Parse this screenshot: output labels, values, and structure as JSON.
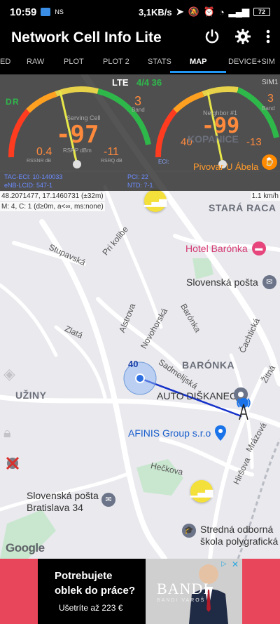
{
  "statusbar": {
    "time": "10:59",
    "ns_label": "NS",
    "speed": "3,1KB/s",
    "battery": "72"
  },
  "appbar": {
    "title": "Network Cell Info Lite",
    "icons": [
      "power-icon",
      "gear-icon",
      "more-vertical-icon"
    ]
  },
  "tabs": {
    "items": [
      "ED",
      "RAW",
      "PLOT",
      "PLOT 2",
      "STATS",
      "MAP",
      "DEVICE+SIM"
    ],
    "active": "MAP"
  },
  "signal_panel": {
    "technology": "LTE",
    "network": "4/4 36",
    "sim_label": "SIM1",
    "serving_cell_label": "Serving Cell",
    "neighbor_label": "Neighbor #1",
    "left_gauge": {
      "d_letter": "D",
      "r_letter": "R",
      "rsrp_value": "-97",
      "rsrp_unit": "RSRP dBm",
      "band_value": "3",
      "band_label": "Band",
      "rssnr_value": "0.4",
      "rssnr_unit": "RSSNR dB",
      "rsrq_value": "-11",
      "rsrq_unit": "RSRQ dB",
      "scale": [
        "-140",
        "-130",
        "-120",
        "-110",
        "-100",
        "-90",
        "-80",
        "-70",
        "-60",
        "-50",
        "-40"
      ],
      "needle_value": -97
    },
    "right_gauge": {
      "rsrp_value": "-99",
      "rsrp_unit": "RSRP dBm",
      "band_value": "3",
      "band_label": "Band",
      "rsrq_value": "-13",
      "rsrq_unit": "RSRQ dB",
      "rssnr_value": "40",
      "ci_label": "ECI:",
      "pci_label": "PCI:",
      "pci_value": "22",
      "scale": [
        "-140",
        "-130",
        "-120",
        "-110",
        "-100",
        "-90",
        "-80",
        "-70",
        "-60",
        "-50",
        "-40"
      ],
      "needle_value": -99
    },
    "cell_info": {
      "tac_eci": "TAC-ECI: 10-140033",
      "enb_lcid": "eNB-LCID: 547-1",
      "pci": "PCI: 22",
      "ntd": "NTD: 7-1"
    },
    "coords": "48.2071477, 17.1460731 (±32m)",
    "speed": "1.1 km/h",
    "mode": "M: 4, C: 1 (d≥0m, a<∞, ms:none)"
  },
  "map": {
    "districts": [
      "STARÁ RACA",
      "BARÓNKA",
      "UŽINY"
    ],
    "streets": [
      "Stupavská",
      "Pri kolibe",
      "Alstrova",
      "Novohorská",
      "Barónka",
      "Zlatá",
      "Sadmelijská",
      "Čachtická",
      "Mrázová",
      "Hečkova",
      "Hiršova",
      "Žitná"
    ],
    "pois": [
      {
        "name": "Hotel Barónka",
        "icon": "bed-icon",
        "color": "#e6467b"
      },
      {
        "name": "Slovenská pošta",
        "icon": "mail-icon",
        "color": "#6b7488"
      },
      {
        "name": "AUTO DIŠKANEC",
        "icon": "location-pin-icon",
        "color": "#6b7488"
      },
      {
        "name": "AFINIS Group s.r.o",
        "icon": "location-pin-icon",
        "color": "#1a73e8"
      },
      {
        "name": "Slovenská pošta Bratislava 34",
        "icon": "mail-icon",
        "color": "#6b7488"
      },
      {
        "name": "Stredná odborná škola polygrafická",
        "icon": "school-icon",
        "color": "#6b7488"
      },
      {
        "name": "Pivovar U Ábela",
        "icon": "beer-icon",
        "color": "#ff8a00"
      },
      {
        "name": "KOPANICE",
        "icon": "",
        "color": "#6b6f7a"
      }
    ],
    "accuracy_label": "40",
    "google_logo": "Google"
  },
  "ad": {
    "line1": "Potrebujete",
    "line2": "oblek do práce?",
    "line3": "Ušetríte až 223 €",
    "brand": "BANDI",
    "brand_sub": "BANDI VAROŠ"
  },
  "colors": {
    "accent": "#2196f3",
    "map_bg": "#e9e9ee",
    "ad_bg": "#e8465a",
    "tower_icon": "#f4e03a"
  }
}
